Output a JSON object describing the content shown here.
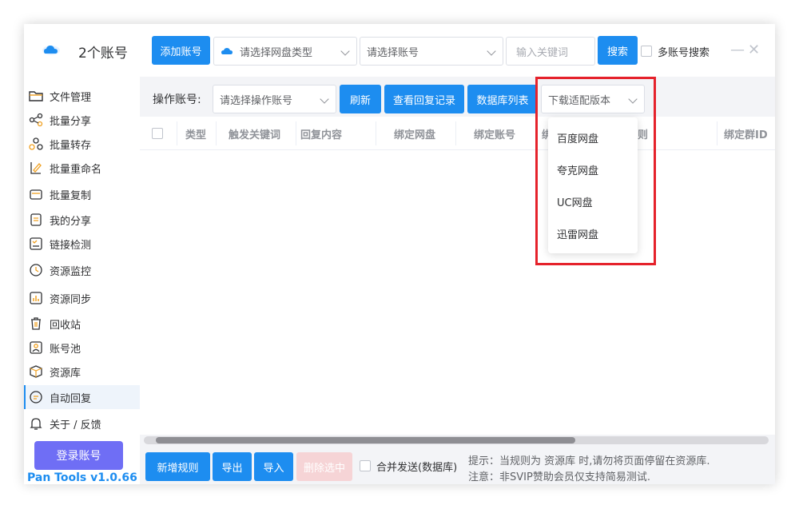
{
  "header": {
    "account_count": "2个账号",
    "add_account": "添加账号",
    "disk_type_placeholder": "请选择网盘类型",
    "account_placeholder": "请选择账号",
    "keyword_placeholder": "输入关键词",
    "search": "搜索",
    "multi_search": "多账号搜索",
    "minimize": "—",
    "close": "✕"
  },
  "sidebar": {
    "items": [
      {
        "label": "文件管理",
        "icon": "folder-icon"
      },
      {
        "label": "批量分享",
        "icon": "share-icon"
      },
      {
        "label": "批量转存",
        "icon": "transfer-icon"
      },
      {
        "label": "批量重命名",
        "icon": "rename-icon"
      },
      {
        "label": "批量复制",
        "icon": "copy-icon"
      },
      {
        "label": "我的分享",
        "icon": "my-share-icon"
      },
      {
        "label": "链接检测",
        "icon": "link-check-icon"
      },
      {
        "label": "资源监控",
        "icon": "monitor-icon"
      },
      {
        "label": "资源同步",
        "icon": "sync-icon"
      },
      {
        "label": "回收站",
        "icon": "trash-icon"
      },
      {
        "label": "账号池",
        "icon": "account-pool-icon"
      },
      {
        "label": "资源库",
        "icon": "library-icon"
      },
      {
        "label": "自动回复",
        "icon": "auto-reply-icon"
      },
      {
        "label": "关于 / 反馈",
        "icon": "bell-icon"
      }
    ],
    "active_index": 12,
    "login": "登录账号",
    "version": "Pan Tools v1.0.66"
  },
  "toolbar": {
    "op_account_label": "操作账号:",
    "op_account_placeholder": "请选择操作账号",
    "refresh": "刷新",
    "reply_log": "查看回复记录",
    "db_list": "数据库列表",
    "download_version": "下载适配版本"
  },
  "table": {
    "columns": [
      "类型",
      "触发关键词",
      "回复内容",
      "绑定网盘",
      "绑定账号",
      "绑",
      "则",
      "绑定群ID"
    ]
  },
  "dropdown": {
    "options": [
      "百度网盘",
      "夸克网盘",
      "UC网盘",
      "迅雷网盘"
    ]
  },
  "footer": {
    "add_rule": "新增规则",
    "export": "导出",
    "import": "导入",
    "delete_selected": "删除选中",
    "merge_send": "合并发送(数据库)",
    "tip1": "提示：当规则为  资源库  时,请勿将页面停留在资源库.",
    "tip2": "注意：非SVIP赞助会员仅支持简易测试."
  },
  "colors": {
    "primary": "#1d8df0",
    "login": "#6f6ef5",
    "highlight": "#e5222b"
  }
}
